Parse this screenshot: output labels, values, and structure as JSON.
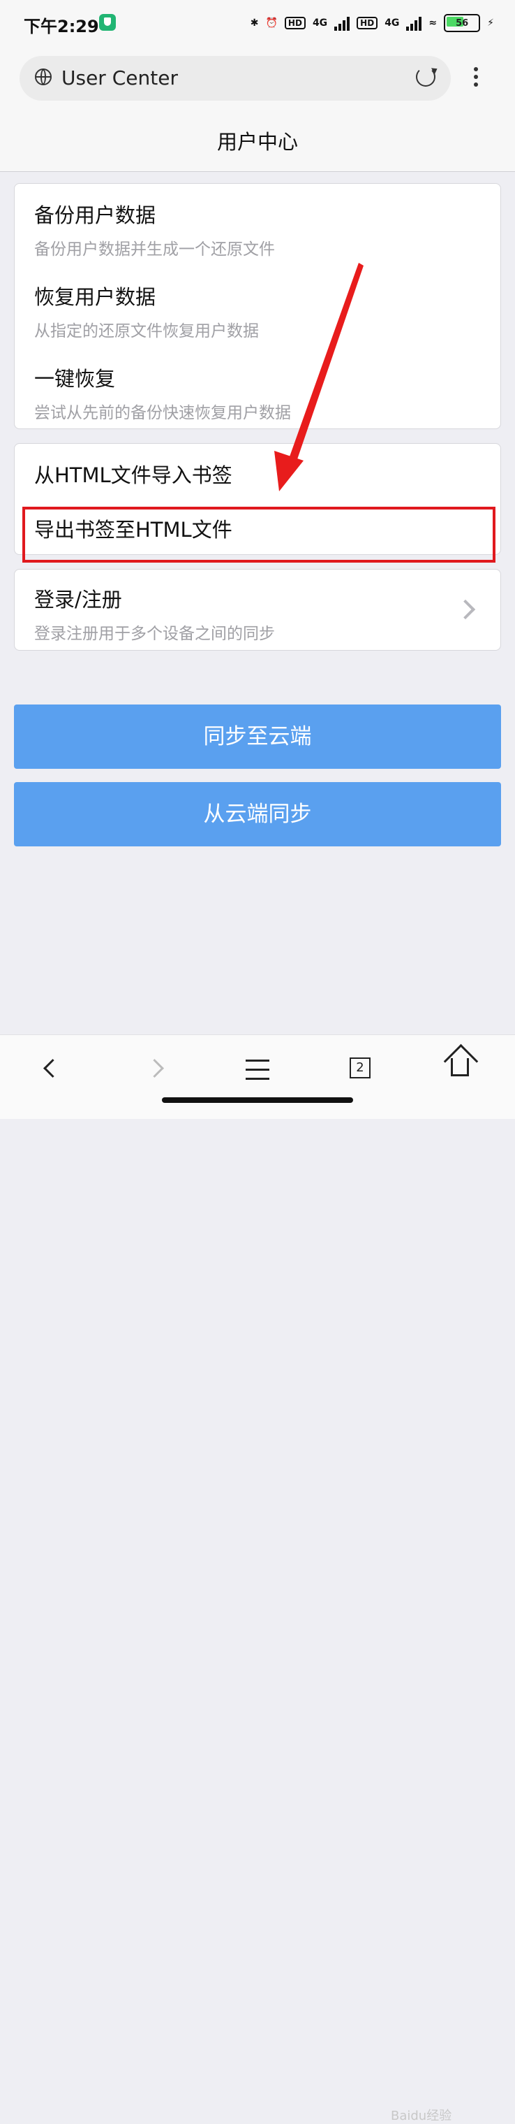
{
  "status_bar": {
    "time": "下午2:29",
    "bluetooth": "✱",
    "alarm": "⏰",
    "hd1": "HD",
    "net1": "4G",
    "hd2": "HD",
    "net2": "4G",
    "wifi": "≈",
    "battery": "56",
    "charging": "⚡"
  },
  "browser": {
    "url_text": "User Center"
  },
  "page": {
    "title": "用户中心"
  },
  "backup_group": [
    {
      "title": "备份用户数据",
      "desc": "备份用户数据并生成一个还原文件"
    },
    {
      "title": "恢复用户数据",
      "desc": "从指定的还原文件恢复用户数据"
    },
    {
      "title": "一键恢复",
      "desc": "尝试从先前的备份快速恢复用户数据"
    }
  ],
  "bookmark_group": [
    {
      "title": "从HTML文件导入书签"
    },
    {
      "title": "导出书签至HTML文件"
    }
  ],
  "account": {
    "title": "登录/注册",
    "desc": "登录注册用于多个设备之间的同步"
  },
  "buttons": {
    "sync_to_cloud": "同步至云端",
    "sync_from_cloud": "从云端同步"
  },
  "bottom_nav": {
    "tab_count": "2"
  },
  "watermark": "Baidu经验",
  "colors": {
    "button_blue": "#5aa0ef",
    "highlight_red": "#e0191e",
    "arrow_red": "#e81c1c"
  }
}
